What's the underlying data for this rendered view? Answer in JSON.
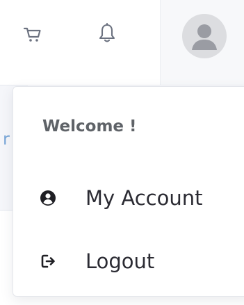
{
  "header": {
    "cart_icon": "cart-icon",
    "notification_icon": "bell-icon",
    "avatar_icon": "user-avatar-icon"
  },
  "background": {
    "partial_text": "r"
  },
  "dropdown": {
    "welcome_text": "Welcome !",
    "items": [
      {
        "label": "My Account",
        "icon": "user-circle-icon"
      },
      {
        "label": "Logout",
        "icon": "sign-out-icon"
      }
    ]
  },
  "colors": {
    "icon": "#6c7280",
    "avatar_bg": "#dcdde0",
    "avatar_fg": "#9a9ca3",
    "text_dark": "#2b2b33",
    "text_muted": "#5f6368",
    "link_blue": "#7aa7d8"
  }
}
